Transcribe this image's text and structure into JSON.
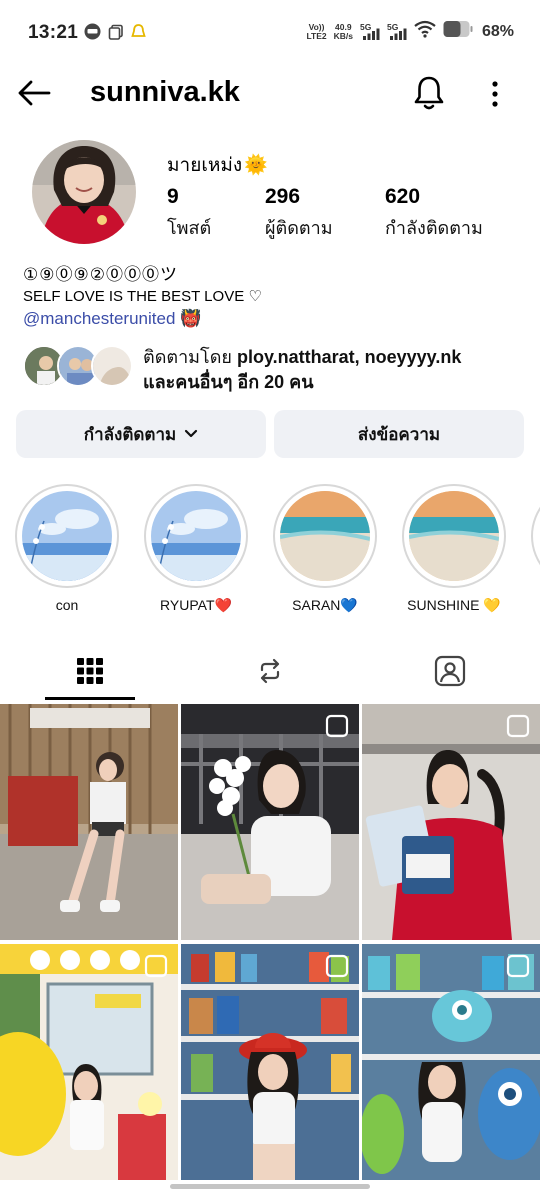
{
  "status_bar": {
    "time": "13:21",
    "volte_top": "Vo))",
    "volte_bottom": "LTE2",
    "speed_value": "40.9",
    "speed_unit": "KB/s",
    "sim1": "5G",
    "sim2": "5G",
    "battery": "68%"
  },
  "header": {
    "username": "sunniva.kk"
  },
  "profile": {
    "display_name": "มายเหม่ง",
    "display_emoji": "🌞",
    "stats": [
      {
        "value": "9",
        "label": "โพสต์"
      },
      {
        "value": "296",
        "label": "ผู้ติดตาม"
      },
      {
        "value": "620",
        "label": "กำลังติดตาม"
      }
    ],
    "bio_line1": "①⑨⓪⑨②⓪⓪⓪ツ",
    "bio_line2": "SELF LOVE IS THE BEST LOVE ♡",
    "bio_mention": "@manchesterunited",
    "bio_mention_emoji": "👹",
    "followed_by_prefix": "ติดตามโดย",
    "followed_by_names": "ploy.nattharat, noeyyyy.nk",
    "followed_by_more": "และคนอื่นๆ อีก 20 คน"
  },
  "actions": {
    "following_label": "กำลังติดตาม",
    "message_label": "ส่งข้อความ"
  },
  "highlights": [
    {
      "label": "con",
      "style": "sea-flowers"
    },
    {
      "label": "RYUPAT❤️",
      "style": "sea-flowers"
    },
    {
      "label": "SARAN💙",
      "style": "beach"
    },
    {
      "label": "SUNSHINE 💛",
      "style": "beach"
    }
  ],
  "tabs": [
    {
      "name": "posts",
      "icon": "grid-icon",
      "active": true
    },
    {
      "name": "reels",
      "icon": "repost-icon",
      "active": false
    },
    {
      "name": "tagged",
      "icon": "tagged-person-icon",
      "active": false
    }
  ],
  "grid_posts": [
    {
      "scene": "girl sitting on chair outdoors",
      "multi": false
    },
    {
      "scene": "girl with white flowers at night",
      "multi": true
    },
    {
      "scene": "girl in red jersey holding cards",
      "multi": true
    },
    {
      "scene": "girl at yellow cafe",
      "multi": true
    },
    {
      "scene": "girl in toy store with red hat",
      "multi": true
    },
    {
      "scene": "girl with blue monster plush",
      "multi": true
    }
  ]
}
